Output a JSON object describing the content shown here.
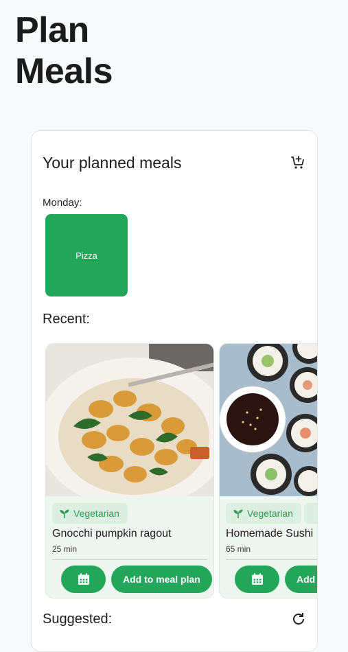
{
  "page": {
    "title_line1": "Plan",
    "title_line2": "Meals"
  },
  "planned": {
    "title": "Your planned meals",
    "cart_icon": "add-shopping-cart-icon",
    "days": [
      {
        "day": "Monday:",
        "meals": [
          "Pizza"
        ]
      }
    ]
  },
  "recent": {
    "label": "Recent:",
    "recipes": [
      {
        "name": "Gnocchi pumpkin ragout",
        "time": "25 min",
        "tag": "Vegetarian",
        "add_label": "Add to meal plan"
      },
      {
        "name": "Homemade Sushi",
        "time": "65 min",
        "tag": "Vegetarian",
        "add_label": "Add t"
      }
    ]
  },
  "suggested": {
    "label": "Suggested:"
  },
  "colors": {
    "accent": "#23a55a",
    "tag_bg": "#dcefe1",
    "tag_text": "#2f9a56",
    "card_bg": "#eef6f0"
  }
}
